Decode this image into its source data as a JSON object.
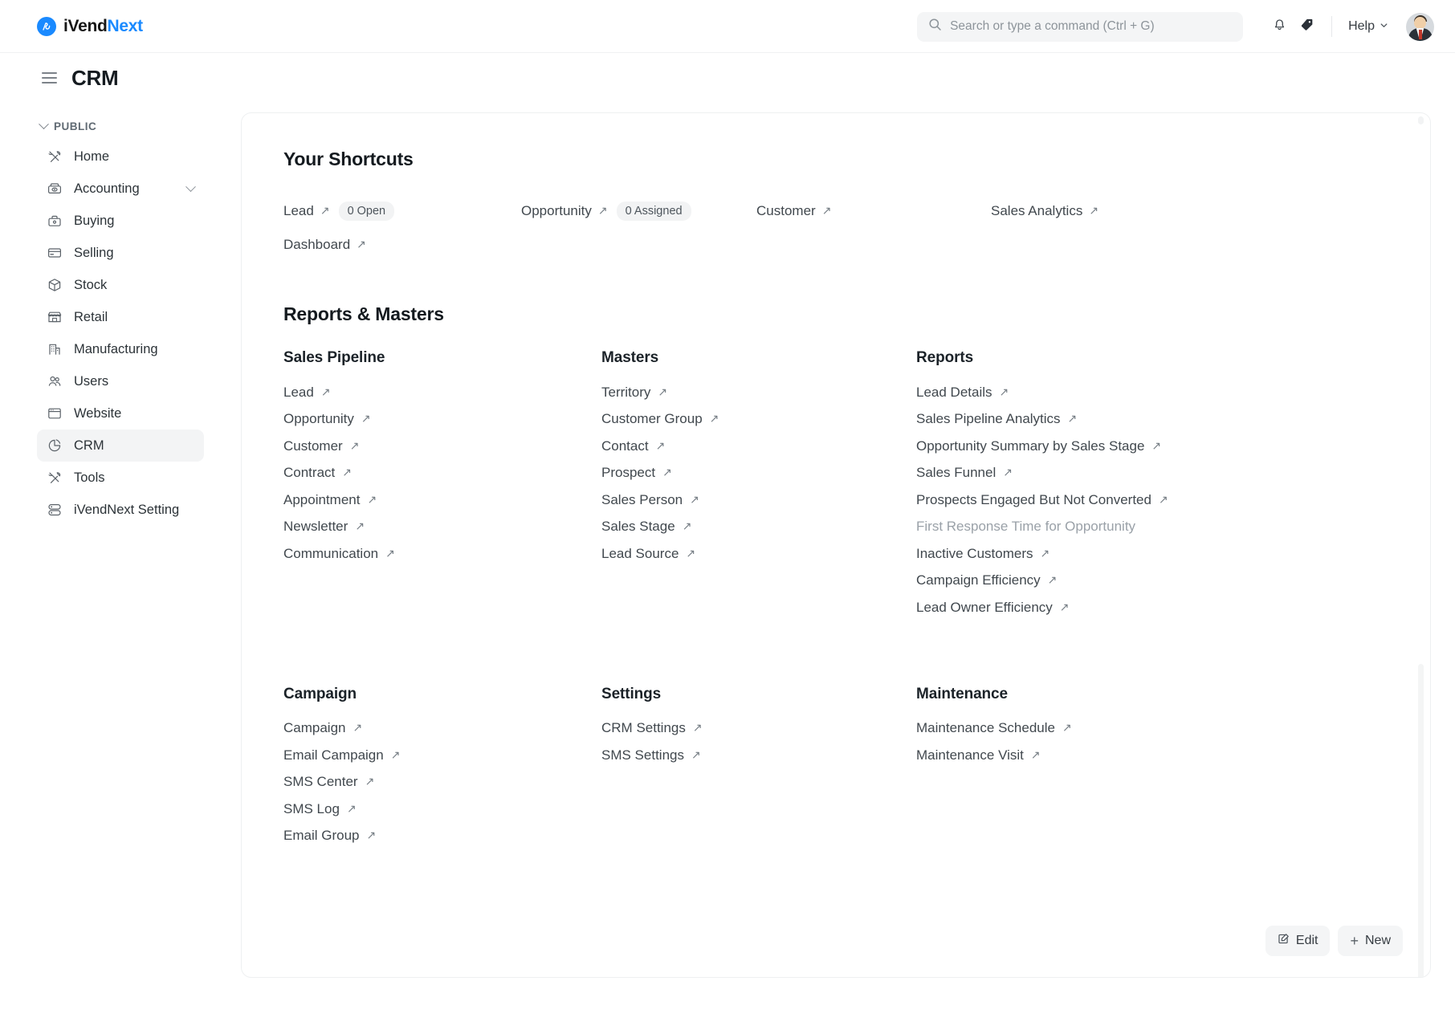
{
  "navbar": {
    "brand_primary": "iVend",
    "brand_secondary": "Next",
    "brand_mark": "iV",
    "search_placeholder": "Search or type a command (Ctrl + G)",
    "search_value": "",
    "help_label": "Help",
    "icons": [
      "search-icon",
      "bell-icon",
      "tag-icon",
      "chevron-down-icon",
      "avatar"
    ]
  },
  "page": {
    "title": "CRM"
  },
  "sidebar": {
    "group_label": "PUBLIC",
    "items": [
      {
        "label": "Home",
        "icon": "tools-icon",
        "active": false,
        "expandable": false
      },
      {
        "label": "Accounting",
        "icon": "cashbox-icon",
        "active": false,
        "expandable": true
      },
      {
        "label": "Buying",
        "icon": "basket-icon",
        "active": false,
        "expandable": false
      },
      {
        "label": "Selling",
        "icon": "card-icon",
        "active": false,
        "expandable": false
      },
      {
        "label": "Stock",
        "icon": "box-icon",
        "active": false,
        "expandable": false
      },
      {
        "label": "Retail",
        "icon": "store-icon",
        "active": false,
        "expandable": false
      },
      {
        "label": "Manufacturing",
        "icon": "factory-icon",
        "active": false,
        "expandable": false
      },
      {
        "label": "Users",
        "icon": "users-icon",
        "active": false,
        "expandable": false
      },
      {
        "label": "Website",
        "icon": "browser-icon",
        "active": false,
        "expandable": false
      },
      {
        "label": "CRM",
        "icon": "pie-chart-icon",
        "active": true,
        "expandable": false
      },
      {
        "label": "Tools",
        "icon": "tools-icon",
        "active": false,
        "expandable": false
      },
      {
        "label": "iVendNext Setting",
        "icon": "server-icon",
        "active": false,
        "expandable": false
      }
    ]
  },
  "main": {
    "shortcuts_title": "Your Shortcuts",
    "shortcuts": [
      {
        "label": "Lead",
        "badge": "0 Open"
      },
      {
        "label": "Opportunity",
        "badge": "0 Assigned"
      },
      {
        "label": "Customer",
        "badge": ""
      },
      {
        "label": "Sales Analytics",
        "badge": ""
      },
      {
        "label": "Dashboard",
        "badge": ""
      }
    ],
    "reports_title": "Reports & Masters",
    "sections": [
      {
        "title": "Sales Pipeline",
        "links": [
          {
            "label": "Lead",
            "dim": false
          },
          {
            "label": "Opportunity",
            "dim": false
          },
          {
            "label": "Customer",
            "dim": false
          },
          {
            "label": "Contract",
            "dim": false
          },
          {
            "label": "Appointment",
            "dim": false
          },
          {
            "label": "Newsletter",
            "dim": false
          },
          {
            "label": "Communication",
            "dim": false
          }
        ]
      },
      {
        "title": "Masters",
        "links": [
          {
            "label": "Territory",
            "dim": false
          },
          {
            "label": "Customer Group",
            "dim": false
          },
          {
            "label": "Contact",
            "dim": false
          },
          {
            "label": "Prospect",
            "dim": false
          },
          {
            "label": "Sales Person",
            "dim": false
          },
          {
            "label": "Sales Stage",
            "dim": false
          },
          {
            "label": "Lead Source",
            "dim": false
          }
        ]
      },
      {
        "title": "Reports",
        "links": [
          {
            "label": "Lead Details",
            "dim": false
          },
          {
            "label": "Sales Pipeline Analytics",
            "dim": false
          },
          {
            "label": "Opportunity Summary by Sales Stage",
            "dim": false
          },
          {
            "label": "Sales Funnel",
            "dim": false
          },
          {
            "label": "Prospects Engaged But Not Converted",
            "dim": false
          },
          {
            "label": "First Response Time for Opportunity",
            "dim": true
          },
          {
            "label": "Inactive Customers",
            "dim": false
          },
          {
            "label": "Campaign Efficiency",
            "dim": false
          },
          {
            "label": "Lead Owner Efficiency",
            "dim": false
          }
        ]
      },
      {
        "title": "Campaign",
        "links": [
          {
            "label": "Campaign",
            "dim": false
          },
          {
            "label": "Email Campaign",
            "dim": false
          },
          {
            "label": "SMS Center",
            "dim": false
          },
          {
            "label": "SMS Log",
            "dim": false
          },
          {
            "label": "Email Group",
            "dim": false
          }
        ]
      },
      {
        "title": "Settings",
        "links": [
          {
            "label": "CRM Settings",
            "dim": false
          },
          {
            "label": "SMS Settings",
            "dim": false
          }
        ]
      },
      {
        "title": "Maintenance",
        "links": [
          {
            "label": "Maintenance Schedule",
            "dim": false
          },
          {
            "label": "Maintenance Visit",
            "dim": false
          }
        ]
      }
    ],
    "actions": {
      "edit_label": "Edit",
      "new_label": "New",
      "new_prefix": "+"
    }
  },
  "colors": {
    "accent": "#1a8aff",
    "text": "#41484e",
    "muted": "#9aa1a8",
    "surface": "#f4f5f6"
  }
}
